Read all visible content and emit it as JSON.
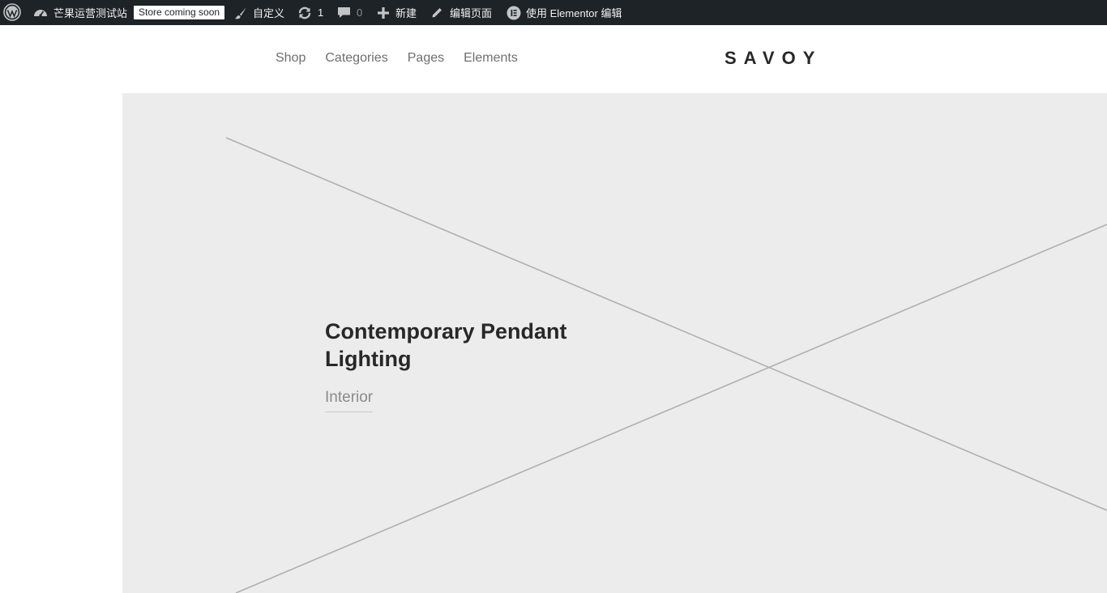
{
  "admin_bar": {
    "site_name": "芒果运营测试站",
    "store_badge": "Store coming soon",
    "customize": "自定义",
    "updates_count": "1",
    "comments_count": "0",
    "new": "新建",
    "edit_page": "编辑页面",
    "edit_with_elementor": "使用 Elementor 编辑",
    "icons": [
      "wordpress-logo-icon",
      "dashboard-icon",
      "brush-icon",
      "refresh-icon",
      "comment-icon",
      "plus-icon",
      "pencil-icon",
      "elementor-icon"
    ]
  },
  "header": {
    "nav": [
      "Shop",
      "Categories",
      "Pages",
      "Elements"
    ],
    "logo": "SAVOY"
  },
  "hero": {
    "title": "Contemporary Pendant Lighting",
    "category_link": "Interior"
  },
  "colors": {
    "admin_bar_bg": "#1d2327",
    "hero_bg": "#ececec",
    "placeholder_lines": "#b0b0b0",
    "text_dark": "#282828",
    "text_muted": "#8a8a8a"
  }
}
